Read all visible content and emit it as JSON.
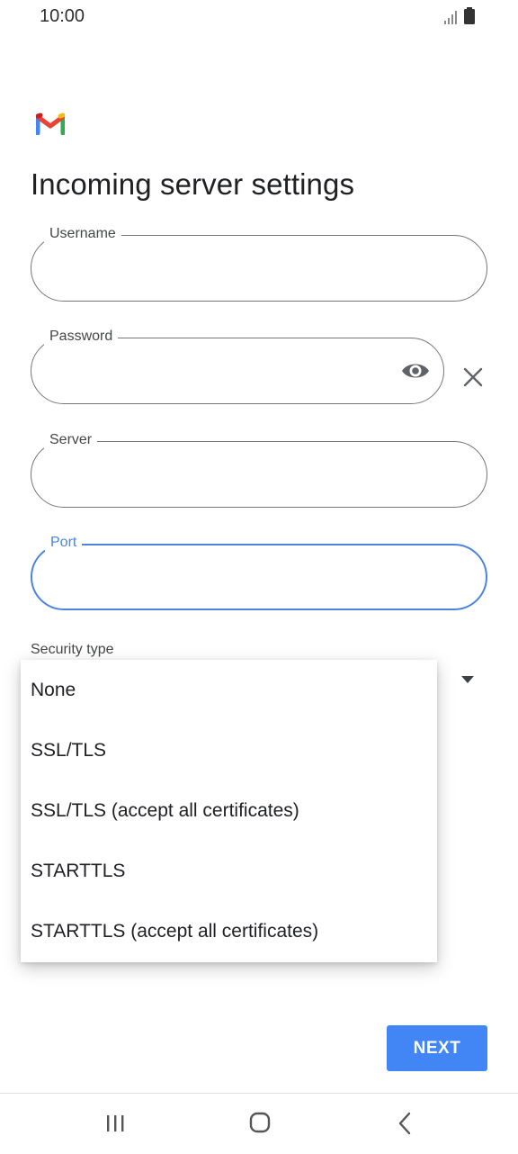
{
  "status_bar": {
    "time": "10:00",
    "icons": [
      "signal-icon",
      "battery-icon"
    ]
  },
  "app": {
    "logo": "gmail-logo",
    "brand_colors": [
      "#4285f4",
      "#ea4335",
      "#fbbc04",
      "#34a853"
    ]
  },
  "page": {
    "title": "Incoming server settings"
  },
  "fields": {
    "username": {
      "label": "Username",
      "value": ""
    },
    "password": {
      "label": "Password",
      "value": ""
    },
    "server": {
      "label": "Server",
      "value": ""
    },
    "port": {
      "label": "Port",
      "value": "",
      "focused": true
    }
  },
  "security": {
    "label": "Security type",
    "options": [
      "None",
      "SSL/TLS",
      "SSL/TLS (accept all certificates)",
      "STARTTLS",
      "STARTTLS (accept all certificates)"
    ]
  },
  "actions": {
    "next_label": "NEXT"
  },
  "colors": {
    "accent": "#4285f4",
    "focus": "#4a84dc"
  },
  "nav": {
    "icons": [
      "recent-apps-icon",
      "home-icon",
      "back-icon"
    ]
  }
}
